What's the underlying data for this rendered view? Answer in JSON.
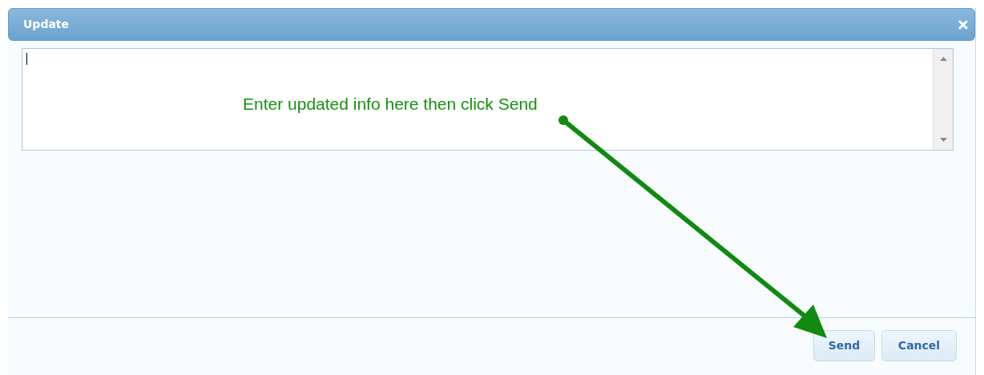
{
  "dialog": {
    "title": "Update",
    "closable": true
  },
  "textarea": {
    "focused": true
  },
  "annotation": {
    "text": "Enter updated info here then click Send"
  },
  "buttons": [
    {
      "label": "Send",
      "kind": "primary"
    },
    {
      "label": "Cancel",
      "kind": "secondary"
    }
  ]
}
